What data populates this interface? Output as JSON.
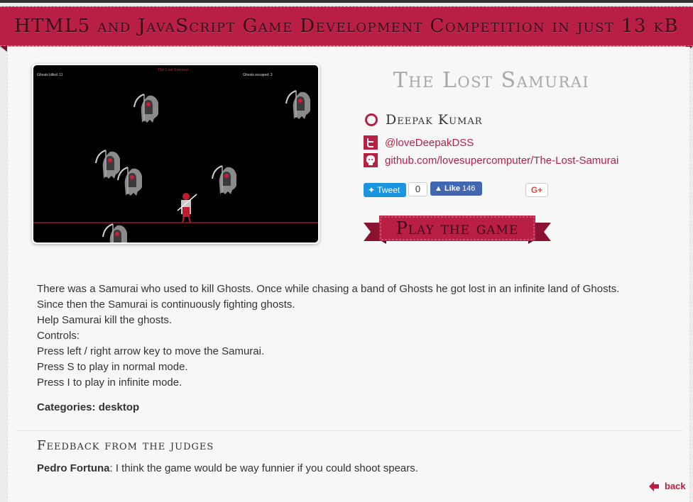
{
  "banner": {
    "title": "HTML5 and JavaScript Game Development Competition in just 13 kB"
  },
  "game": {
    "title": "The Lost Samurai",
    "author": "Deepak Kumar",
    "twitter": "@loveDeepakDSS",
    "github": "github.com/lovesupercomputer/The-Lost-Samurai",
    "play_label": "Play the game"
  },
  "screenshot": {
    "kills_label": "Ghosts killed: 11",
    "escaped_label": "Ghosts escaped: 3",
    "game_title": "The Lost Samurai"
  },
  "social": {
    "tweet_label": "Tweet",
    "tweet_count": "0",
    "like_label": "Like",
    "like_count": "146",
    "gplus_label": "G+"
  },
  "description": {
    "lines": [
      "There was a Samurai who used to kill Ghosts. Once while chasing a band of Ghosts he got lost in an infinite land of Ghosts.",
      "Since then the Samurai is continuously fighting ghosts.",
      "Help Samurai kill the ghosts.",
      "Controls:",
      "Press left / right arrow key to move the Samurai.",
      "Press S to play in normal mode.",
      "Press I to play in infinite mode."
    ],
    "categories_label": "Categories:",
    "categories_value": "desktop"
  },
  "feedback": {
    "heading": "Feedback from the judges",
    "judge": "Pedro Fortuna",
    "comment": ": I think the game would be way funnier if you could shoot spears."
  },
  "nav": {
    "back_label": "back"
  },
  "colors": {
    "accent": "#b91f45",
    "banner_text": "#3a0c18",
    "title_gray": "#a8a8a8"
  },
  "icons": [
    "ring-icon",
    "twitter-icon",
    "github-icon",
    "twitter-bird-icon",
    "facebook-thumb-icon",
    "back-arrow-icon"
  ]
}
